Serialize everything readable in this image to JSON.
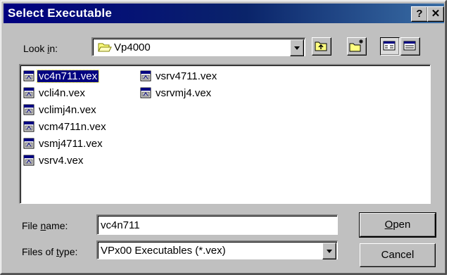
{
  "title": "Select Executable",
  "title_buttons": {
    "help": "?",
    "close": "✕"
  },
  "look_in": {
    "label_prefix": "Look ",
    "label_accel": "i",
    "label_suffix": "n:",
    "value": "Vp4000"
  },
  "toolbar": {
    "up": "up-one-level-icon",
    "new_folder": "new-folder-icon",
    "list_view": "list-view-icon",
    "details_view": "details-view-icon"
  },
  "files": {
    "col1": [
      "vc4n711.vex",
      "vcli4n.vex",
      "vclimj4n.vex",
      "vcm4711n.vex",
      "vsmj4711.vex",
      "vsrv4.vex"
    ],
    "col2": [
      "vsrv4711.vex",
      "vsrvmj4.vex"
    ],
    "selected": "vc4n711.vex"
  },
  "file_name": {
    "label_prefix": "File ",
    "label_accel": "n",
    "label_suffix": "ame:",
    "value": "vc4n711"
  },
  "file_type": {
    "label_prefix": "Files of ",
    "label_accel": "t",
    "label_suffix": "ype:",
    "value": "VPx00 Executables (*.vex)"
  },
  "buttons": {
    "open": {
      "accel": "O",
      "rest": "pen"
    },
    "cancel": "Cancel"
  },
  "colors": {
    "title_start": "#000080",
    "title_end": "#3a6ea5",
    "face": "#c0c0c0",
    "selection": "#000080"
  }
}
